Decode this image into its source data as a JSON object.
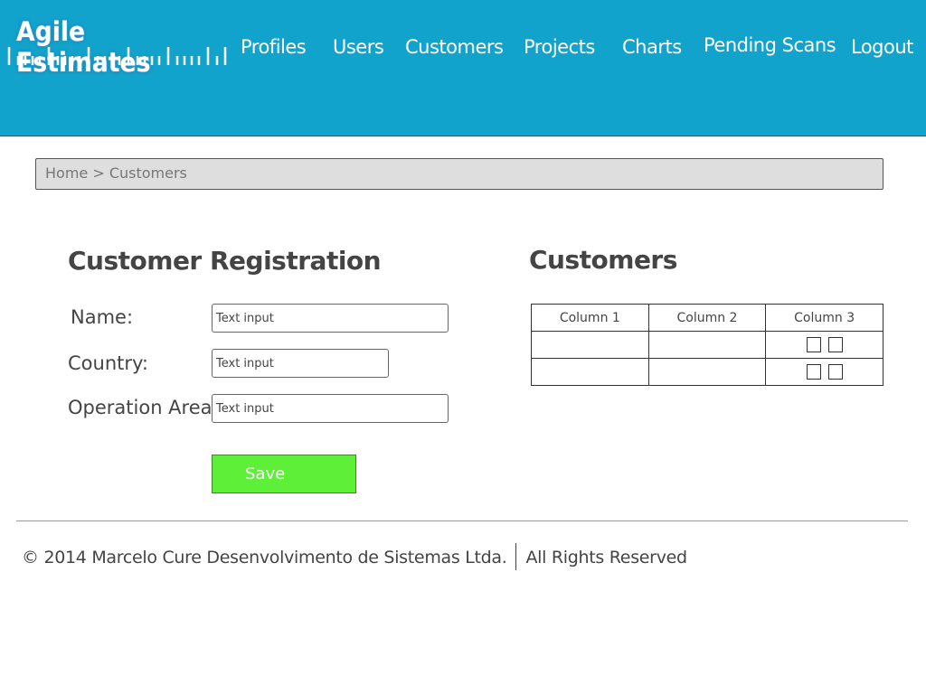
{
  "app": {
    "logo_text": "Agile Estimates"
  },
  "nav": {
    "items": [
      {
        "label": "Profiles"
      },
      {
        "label": "Users"
      },
      {
        "label": "Customers"
      },
      {
        "label": "Projects"
      },
      {
        "label": "Charts"
      },
      {
        "label": "Pending Scans"
      },
      {
        "label": "Logout"
      }
    ]
  },
  "breadcrumb": {
    "text": "Home > Customers"
  },
  "registration": {
    "title": "Customer Registration",
    "fields": [
      {
        "label": "Name:",
        "placeholder": "Text input"
      },
      {
        "label": "Country:",
        "placeholder": "Text input"
      },
      {
        "label": "Operation Area:",
        "placeholder": "Text input"
      }
    ],
    "save_label": "Save"
  },
  "customers": {
    "title": "Customers",
    "columns": [
      "Column 1",
      "Column 2",
      "Column 3"
    ],
    "rows": [
      {
        "col1": "",
        "col2": ""
      },
      {
        "col1": "",
        "col2": ""
      }
    ]
  },
  "footer": {
    "copyright": "© 2014 Marcelo Cure Desenvolvimento de Sistemas Ltda.",
    "rights": "All Rights Reserved"
  },
  "colors": {
    "header_bg": "#11a3cb",
    "save_button": "#5eef38",
    "breadcrumb_bg": "#dedede"
  }
}
